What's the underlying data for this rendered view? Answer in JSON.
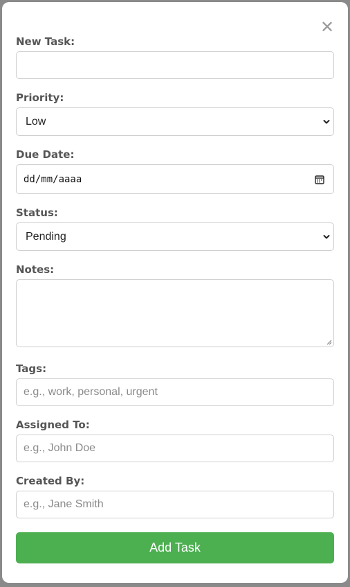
{
  "form": {
    "close_glyph": "✕",
    "task": {
      "label": "New Task:",
      "value": ""
    },
    "priority": {
      "label": "Priority:",
      "selected": "Low"
    },
    "due_date": {
      "label": "Due Date:",
      "placeholder": "dd/mm/aaaa"
    },
    "status": {
      "label": "Status:",
      "selected": "Pending"
    },
    "notes": {
      "label": "Notes:",
      "value": ""
    },
    "tags": {
      "label": "Tags:",
      "placeholder": "e.g., work, personal, urgent"
    },
    "assigned_to": {
      "label": "Assigned To:",
      "placeholder": "e.g., John Doe"
    },
    "created_by": {
      "label": "Created By:",
      "placeholder": "e.g., Jane Smith"
    },
    "submit_label": "Add Task"
  },
  "colors": {
    "accent": "#4caf50",
    "overlay": "#8a8a8a",
    "label": "#555555",
    "border": "#cfcfcf"
  },
  "icons": {
    "close": "close-icon",
    "select": "chevron-down-icon",
    "date": "calendar-icon"
  }
}
